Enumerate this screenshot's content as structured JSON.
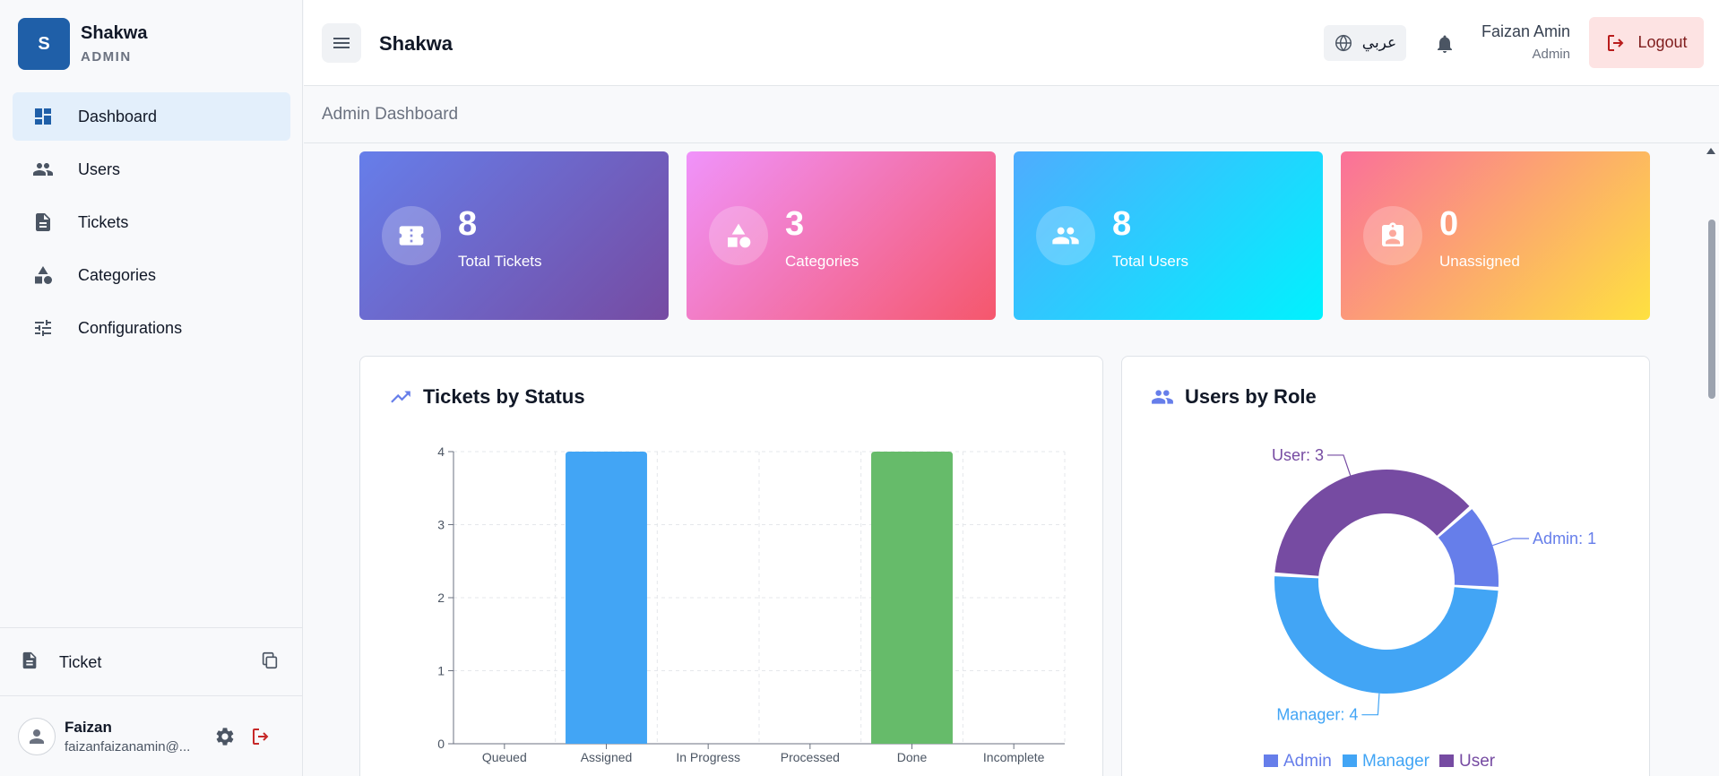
{
  "brand": {
    "logo_letter": "S",
    "name": "Shakwa",
    "role": "ADMIN"
  },
  "sidebar": {
    "items": [
      {
        "label": "Dashboard",
        "icon": "dashboard-icon",
        "active": true
      },
      {
        "label": "Users",
        "icon": "users-icon"
      },
      {
        "label": "Tickets",
        "icon": "document-icon"
      },
      {
        "label": "Categories",
        "icon": "shapes-icon"
      },
      {
        "label": "Configurations",
        "icon": "tune-icon"
      }
    ],
    "ticket_label": "Ticket",
    "user": {
      "name": "Faizan",
      "email": "faizanfaizanamin@..."
    }
  },
  "header": {
    "title": "Shakwa",
    "language_label": "عربي",
    "user_name": "Faizan Amin",
    "user_role": "Admin",
    "logout_label": "Logout"
  },
  "breadcrumb": "Admin Dashboard",
  "stats": [
    {
      "value": "8",
      "label": "Total Tickets",
      "icon": "ticket-icon",
      "gradient": [
        "#667eea",
        "#764ba2"
      ]
    },
    {
      "value": "3",
      "label": "Categories",
      "icon": "shapes-icon",
      "gradient": [
        "#f093fb",
        "#f5576c"
      ]
    },
    {
      "value": "8",
      "label": "Total Users",
      "icon": "users-icon",
      "gradient": [
        "#4facfe",
        "#00f2fe"
      ]
    },
    {
      "value": "0",
      "label": "Unassigned",
      "icon": "badge-icon",
      "gradient": [
        "#fa709a",
        "#fee140"
      ]
    }
  ],
  "panels": {
    "status_title": "Tickets by Status",
    "role_title": "Users by Role"
  },
  "chart_data": [
    {
      "type": "bar",
      "title": "Tickets by Status",
      "categories": [
        "Queued",
        "Assigned",
        "In Progress",
        "Processed",
        "Done",
        "Incomplete"
      ],
      "values": [
        0,
        4,
        0,
        0,
        4,
        0
      ],
      "colors": [
        "#42a5f5",
        "#42a5f5",
        "#42a5f5",
        "#42a5f5",
        "#66bb6a",
        "#42a5f5"
      ],
      "ylim": [
        0,
        4
      ],
      "yticks": [
        0,
        1,
        2,
        3,
        4
      ],
      "grid": true
    },
    {
      "type": "pie",
      "title": "Users by Role",
      "labels": [
        "Admin",
        "Manager",
        "User"
      ],
      "values": [
        1,
        4,
        3
      ],
      "colors": [
        "#667eea",
        "#42a5f5",
        "#764ba2"
      ],
      "data_labels": [
        "Admin: 1",
        "Manager: 4",
        "User: 3"
      ],
      "legend": "bottom",
      "donut": true
    }
  ]
}
